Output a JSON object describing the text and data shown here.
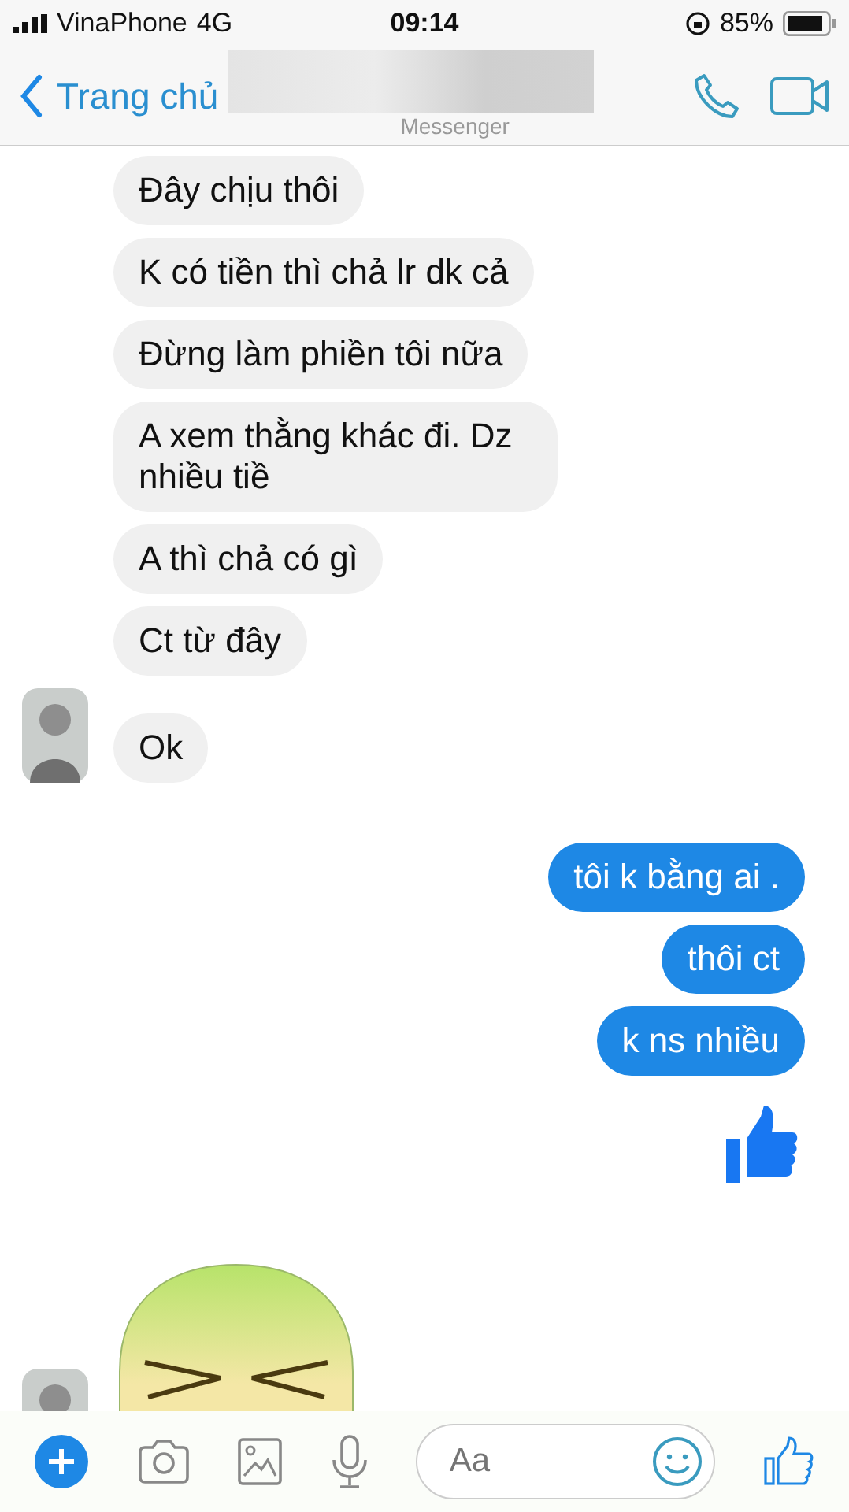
{
  "status_bar": {
    "carrier": "VinaPhone",
    "network": "4G",
    "time": "09:14",
    "battery": "85%"
  },
  "header": {
    "back_label": "Trang chủ",
    "subtitle": "Messenger"
  },
  "messages": [
    {
      "kind": "text",
      "outgoing": false,
      "text": "Đây chịu thôi",
      "avatar": false
    },
    {
      "kind": "text",
      "outgoing": false,
      "text": "K có tiền thì chả lr dk cả",
      "avatar": false
    },
    {
      "kind": "text",
      "outgoing": false,
      "text": "Đừng làm phiền tôi nữa",
      "avatar": false
    },
    {
      "kind": "text",
      "outgoing": false,
      "text": "A xem thằng khác đi. Dz nhiều tiề",
      "avatar": false
    },
    {
      "kind": "text",
      "outgoing": false,
      "text": "A thì chả có gì",
      "avatar": false
    },
    {
      "kind": "text",
      "outgoing": false,
      "text": "Ct từ đây",
      "avatar": false
    },
    {
      "kind": "text",
      "outgoing": false,
      "text": "Ok",
      "avatar": true
    },
    {
      "kind": "text",
      "outgoing": true,
      "text": "tôi k bằng ai ."
    },
    {
      "kind": "text",
      "outgoing": true,
      "text": "thôi ct"
    },
    {
      "kind": "text",
      "outgoing": true,
      "text": "k ns nhiều"
    },
    {
      "kind": "like",
      "outgoing": true
    },
    {
      "kind": "sticker",
      "outgoing": false,
      "avatar": true
    }
  ],
  "composer": {
    "placeholder": "Aa"
  }
}
